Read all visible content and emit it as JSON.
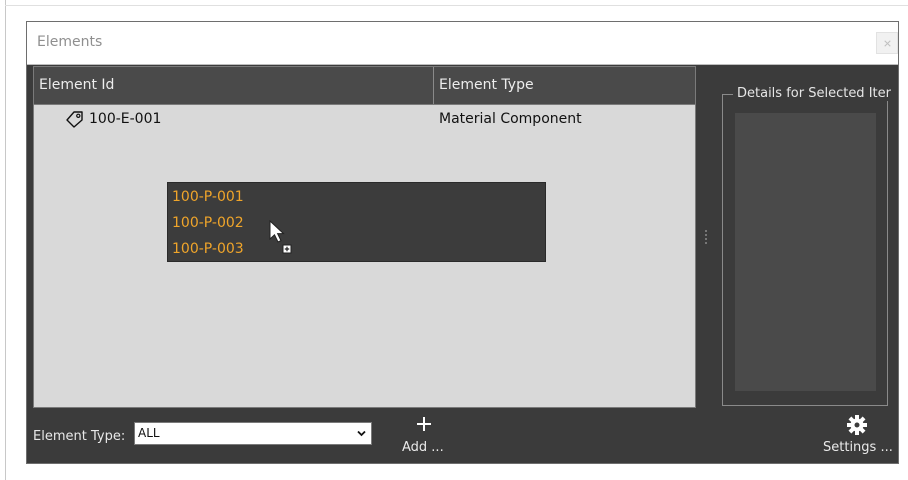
{
  "window": {
    "title": "Elements"
  },
  "grid": {
    "columns": [
      "Element Id",
      "Element Type"
    ],
    "rows": [
      {
        "id": "100-E-001",
        "type": "Material Component",
        "icon": "tag-icon"
      }
    ]
  },
  "drag_popup": {
    "items": [
      "100-P-001",
      "100-P-002",
      "100-P-003"
    ]
  },
  "details": {
    "title": "Details for Selected Iter"
  },
  "toolbar": {
    "element_type_label": "Element Type:",
    "element_type_value": "ALL",
    "add_label": "Add ...",
    "settings_label": "Settings ..."
  },
  "colors": {
    "window_bg": "#3b3b3b",
    "grid_bg": "#d9d9d9",
    "drag_text": "#f0a52a"
  }
}
